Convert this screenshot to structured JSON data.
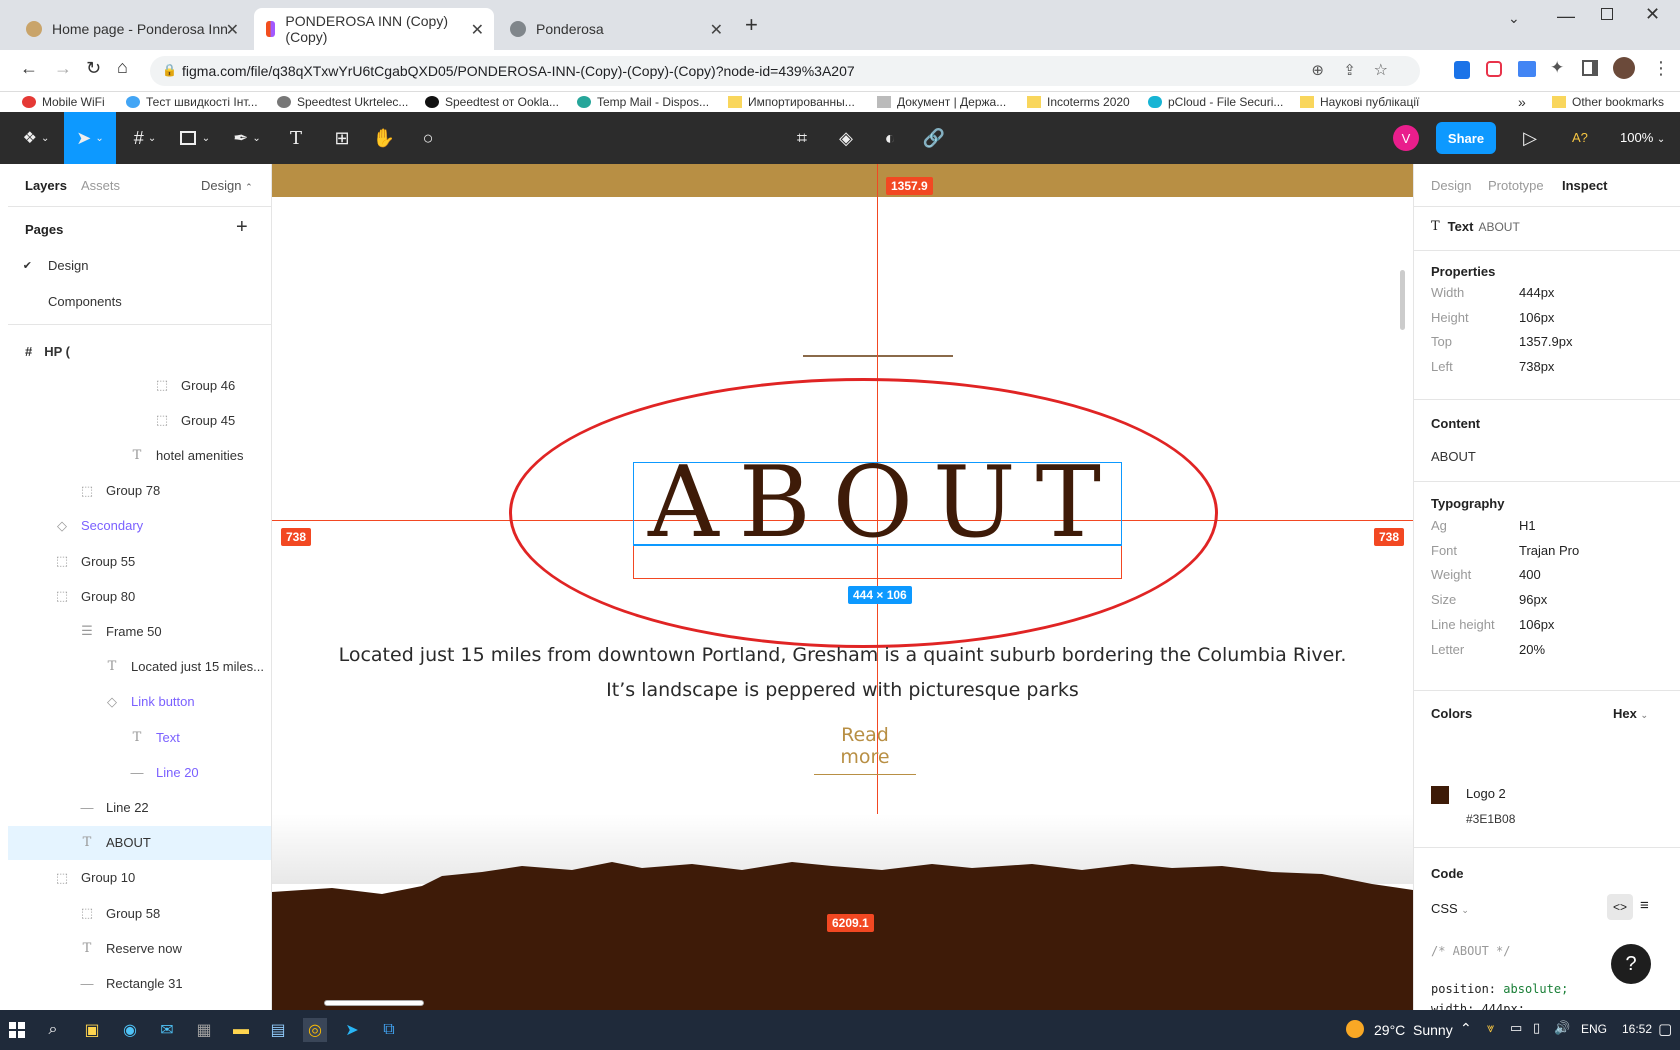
{
  "browser": {
    "tabs": [
      {
        "title": "Home page - Ponderosa Inn",
        "color": "#c9a46a"
      },
      {
        "title": "PONDEROSA INN (Copy) (Copy)",
        "color": "#f24e1e"
      },
      {
        "title": "Ponderosa",
        "color": "#5f6368"
      }
    ],
    "url": "figma.com/file/q38qXTxwYrU6tCgabQXD05/PONDEROSA-INN-(Copy)-(Copy)-(Copy)?node-id=439%3A207",
    "bookmarks": [
      "Mobile WiFi",
      "Тест швидкості Інт...",
      "Speedtest Ukrtelec...",
      "Speedtest от Ookla...",
      "Temp Mail - Dispos...",
      "Импортированны...",
      "Документ | Держа...",
      "Incoterms 2020",
      "pCloud - File Securi...",
      "Наукові публікації"
    ],
    "other_bookmarks": "Other bookmarks"
  },
  "figma": {
    "avatar_letter": "V",
    "share_label": "Share",
    "access_label": "A?",
    "zoom": "100%"
  },
  "left_panel": {
    "tabs": [
      "Layers",
      "Assets"
    ],
    "page_dropdown": "Design",
    "pages_title": "Pages",
    "pages": [
      "Design",
      "Components"
    ],
    "frame_name": "HP (",
    "layers": [
      {
        "name": "Group 46",
        "icon": "group-icon",
        "purple": false
      },
      {
        "name": "Group 45",
        "icon": "group-icon",
        "purple": false
      },
      {
        "name": "hotel amenities",
        "icon": "text-icon",
        "purple": false
      },
      {
        "name": "Group 78",
        "icon": "group-icon",
        "purple": false
      },
      {
        "name": "Secondary",
        "icon": "component-icon",
        "purple": true
      },
      {
        "name": "Group 55",
        "icon": "group-icon",
        "purple": false
      },
      {
        "name": "Group 80",
        "icon": "group-icon",
        "purple": false
      },
      {
        "name": "Frame 50",
        "icon": "frame-icon",
        "purple": false
      },
      {
        "name": "Located just 15 miles...",
        "icon": "text-icon",
        "purple": false
      },
      {
        "name": "Link button",
        "icon": "component-icon",
        "purple": true
      },
      {
        "name": "Text",
        "icon": "text-icon",
        "purple": true
      },
      {
        "name": "Line 20",
        "icon": "line-icon",
        "purple": true
      },
      {
        "name": "Line 22",
        "icon": "line-icon",
        "purple": false
      },
      {
        "name": "ABOUT",
        "icon": "text-icon",
        "purple": false,
        "selected": true
      },
      {
        "name": "Group 10",
        "icon": "group-icon",
        "purple": false
      },
      {
        "name": "Group 58",
        "icon": "group-icon",
        "purple": false
      },
      {
        "name": "Reserve now",
        "icon": "text-icon",
        "purple": false
      },
      {
        "name": "Rectangle 31",
        "icon": "line-icon",
        "purple": false
      }
    ]
  },
  "canvas": {
    "heading": "ABOUT",
    "paragraph_line1": "Located just 15 miles from downtown Portland, Gresham is a quaint suburb bordering the Columbia River.",
    "paragraph_line2": "It’s landscape is peppered with picturesque parks",
    "link": "Read more",
    "measure_top": "1357.9",
    "measure_left": "738",
    "measure_right": "738",
    "measure_bottom": "6209.1",
    "size_label": "444 × 106",
    "brand_color": "#3E1B08",
    "gold_color": "#B88F44"
  },
  "right_panel": {
    "tabs": [
      "Design",
      "Prototype",
      "Inspect"
    ],
    "layer_type": "Text",
    "layer_name": "ABOUT",
    "properties_title": "Properties",
    "properties": [
      {
        "k": "Width",
        "v": "444px"
      },
      {
        "k": "Height",
        "v": "106px"
      },
      {
        "k": "Top",
        "v": "1357.9px"
      },
      {
        "k": "Left",
        "v": "738px"
      }
    ],
    "content_title": "Content",
    "content_value": "ABOUT",
    "typography_title": "Typography",
    "typography": [
      {
        "k": "Ag",
        "v": "H1"
      },
      {
        "k": "Font",
        "v": "Trajan Pro"
      },
      {
        "k": "Weight",
        "v": "400"
      },
      {
        "k": "Size",
        "v": "96px"
      },
      {
        "k": "Line height",
        "v": "106px"
      },
      {
        "k": "Letter",
        "v": "20%"
      }
    ],
    "colors_title": "Colors",
    "color_format": "Hex",
    "color_name": "Logo 2",
    "color_hex": "#3E1B08",
    "code_title": "Code",
    "code_lang": "CSS",
    "code_comment": "/* ABOUT */",
    "code_line_prop": "position:",
    "code_line_val": "absolute;",
    "code_line2": "width: 444px;"
  },
  "taskbar": {
    "temperature": "29°C",
    "weather": "Sunny",
    "lang": "ENG",
    "time": "16:52"
  }
}
